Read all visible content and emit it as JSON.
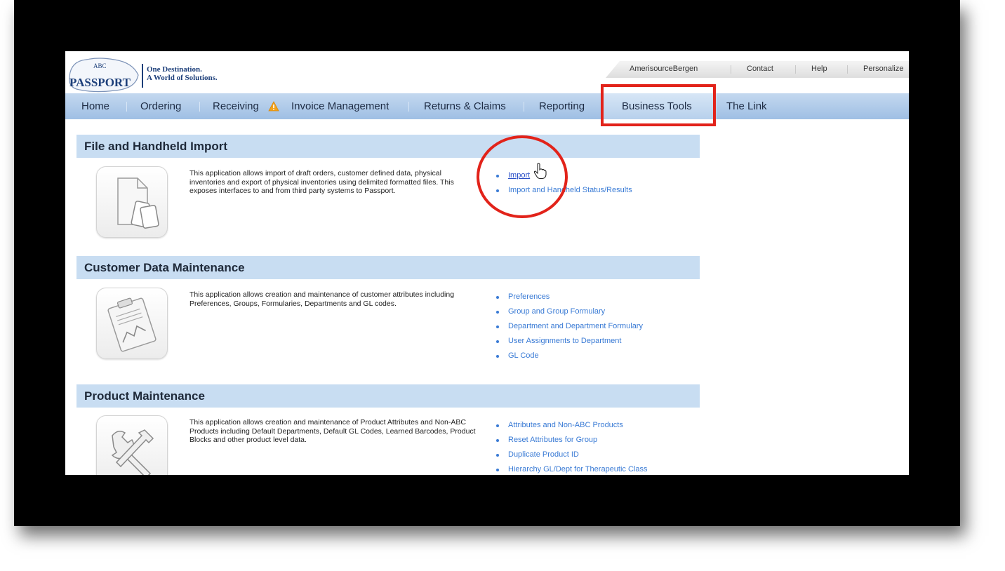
{
  "header": {
    "logo_top": "ABC",
    "logo_main": "PASSPORT",
    "tagline_line1": "One Destination.",
    "tagline_line2": "A World of Solutions.",
    "util_links": [
      "AmerisourceBergen",
      "Contact",
      "Help",
      "Personalize"
    ]
  },
  "nav": {
    "items": [
      "Home",
      "Ordering",
      "Receiving",
      "Invoice Management",
      "Returns & Claims",
      "Reporting",
      "Business Tools",
      "The Link"
    ],
    "active": "Business Tools",
    "warning_icon": "warning-icon"
  },
  "sections": [
    {
      "title": "File and Handheld Import",
      "icon": "file-handheld-icon",
      "description": "This application allows import of draft orders, customer defined data, physical inventories and export of physical inventories using delimited formatted files. This exposes interfaces to and from third party systems to Passport.",
      "links": [
        "Import",
        "Import and Handheld Status/Results"
      ]
    },
    {
      "title": "Customer Data Maintenance",
      "icon": "clipboard-chart-icon",
      "description": "This application allows creation and maintenance of customer attributes including Preferences, Groups, Formularies, Departments and GL codes.",
      "links": [
        "Preferences",
        "Group and Group Formulary",
        "Department and Department Formulary",
        "User Assignments to Department",
        "GL Code"
      ]
    },
    {
      "title": "Product Maintenance",
      "icon": "tools-icon",
      "description": "This application allows creation and maintenance of Product Attributes and Non-ABC Products including Default Departments, Default GL Codes, Learned Barcodes, Product Blocks and other product level data.",
      "links": [
        "Attributes and Non-ABC Products",
        "Reset Attributes for Group",
        "Duplicate Product ID",
        "Hierarchy GL/Dept for Therapeutic Class"
      ]
    }
  ],
  "colors": {
    "highlight": "#e2231a",
    "nav_bg": "#a9c7e8",
    "section_bg": "#c8ddf2",
    "link": "#3a7bd5"
  }
}
